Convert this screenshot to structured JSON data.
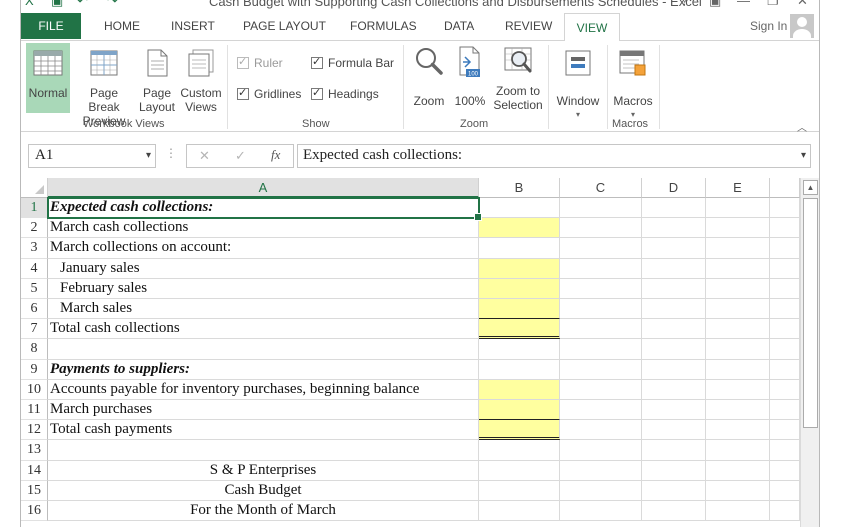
{
  "window": {
    "title": "Cash Budget with Supporting Cash Collections and Disbursements Schedules - Excel",
    "help": "?",
    "ribbon_display": "▣",
    "minimize": "—",
    "restore": "❐",
    "close": "✕"
  },
  "quick_access": {
    "excel_icon": "X",
    "save_icon": "▣",
    "undo_icon": "↶",
    "redo_icon": "↷"
  },
  "tabs": {
    "file": "FILE",
    "items": [
      "HOME",
      "INSERT",
      "PAGE LAYOUT",
      "FORMULAS",
      "DATA",
      "REVIEW"
    ],
    "active": "VIEW",
    "sign_in": "Sign In"
  },
  "ribbon": {
    "groups": {
      "workbook_views": "Workbook Views",
      "show": "Show",
      "zoom": "Zoom",
      "macros": "Macros"
    },
    "normal": "Normal",
    "page_break_preview": [
      "Page Break",
      "Preview"
    ],
    "page_layout": [
      "Page",
      "Layout"
    ],
    "custom_views": [
      "Custom",
      "Views"
    ],
    "ruler": "Ruler",
    "formula_bar": "Formula Bar",
    "gridlines": "Gridlines",
    "headings": "Headings",
    "zoom": "Zoom",
    "zoom_100": "100%",
    "zoom_to_selection": [
      "Zoom to",
      "Selection"
    ],
    "window": "Window",
    "macros": "Macros"
  },
  "formula_bar": {
    "name_box": "A1",
    "cancel": "✕",
    "enter": "✓",
    "fx": "fx",
    "content": "Expected cash collections:"
  },
  "columns": [
    "A",
    "B",
    "C",
    "D",
    "E"
  ],
  "rows": [
    {
      "num": "1",
      "a": "Expected cash collections:",
      "style": "bold-italic"
    },
    {
      "num": "2",
      "a": "March cash collections",
      "b_yellow": true
    },
    {
      "num": "3",
      "a": "March collections on account:"
    },
    {
      "num": "4",
      "a": "January sales",
      "indent": true,
      "b_yellow": true
    },
    {
      "num": "5",
      "a": "February sales",
      "indent": true,
      "b_yellow": true
    },
    {
      "num": "6",
      "a": "March sales",
      "indent": true,
      "b_yellow": true,
      "b_ul": "single"
    },
    {
      "num": "7",
      "a": "Total cash collections",
      "b_yellow": true,
      "b_ul": "double"
    },
    {
      "num": "8",
      "a": ""
    },
    {
      "num": "9",
      "a": "Payments to suppliers:",
      "style": "bold-italic"
    },
    {
      "num": "10",
      "a": "Accounts payable for inventory purchases, beginning balance",
      "b_yellow": true
    },
    {
      "num": "11",
      "a": "March purchases",
      "b_yellow": true,
      "b_ul": "single"
    },
    {
      "num": "12",
      "a": "Total cash payments",
      "b_yellow": true,
      "b_ul": "double"
    },
    {
      "num": "13",
      "a": ""
    },
    {
      "num": "14",
      "a": "S & P Enterprises",
      "center": true
    },
    {
      "num": "15",
      "a": "Cash Budget",
      "center": true
    },
    {
      "num": "16",
      "a": "For the Month of March",
      "center": true
    }
  ],
  "colors": {
    "excel_green": "#217346",
    "input_yellow": "#ffff9f",
    "normal_active": "#a9d8b8"
  }
}
